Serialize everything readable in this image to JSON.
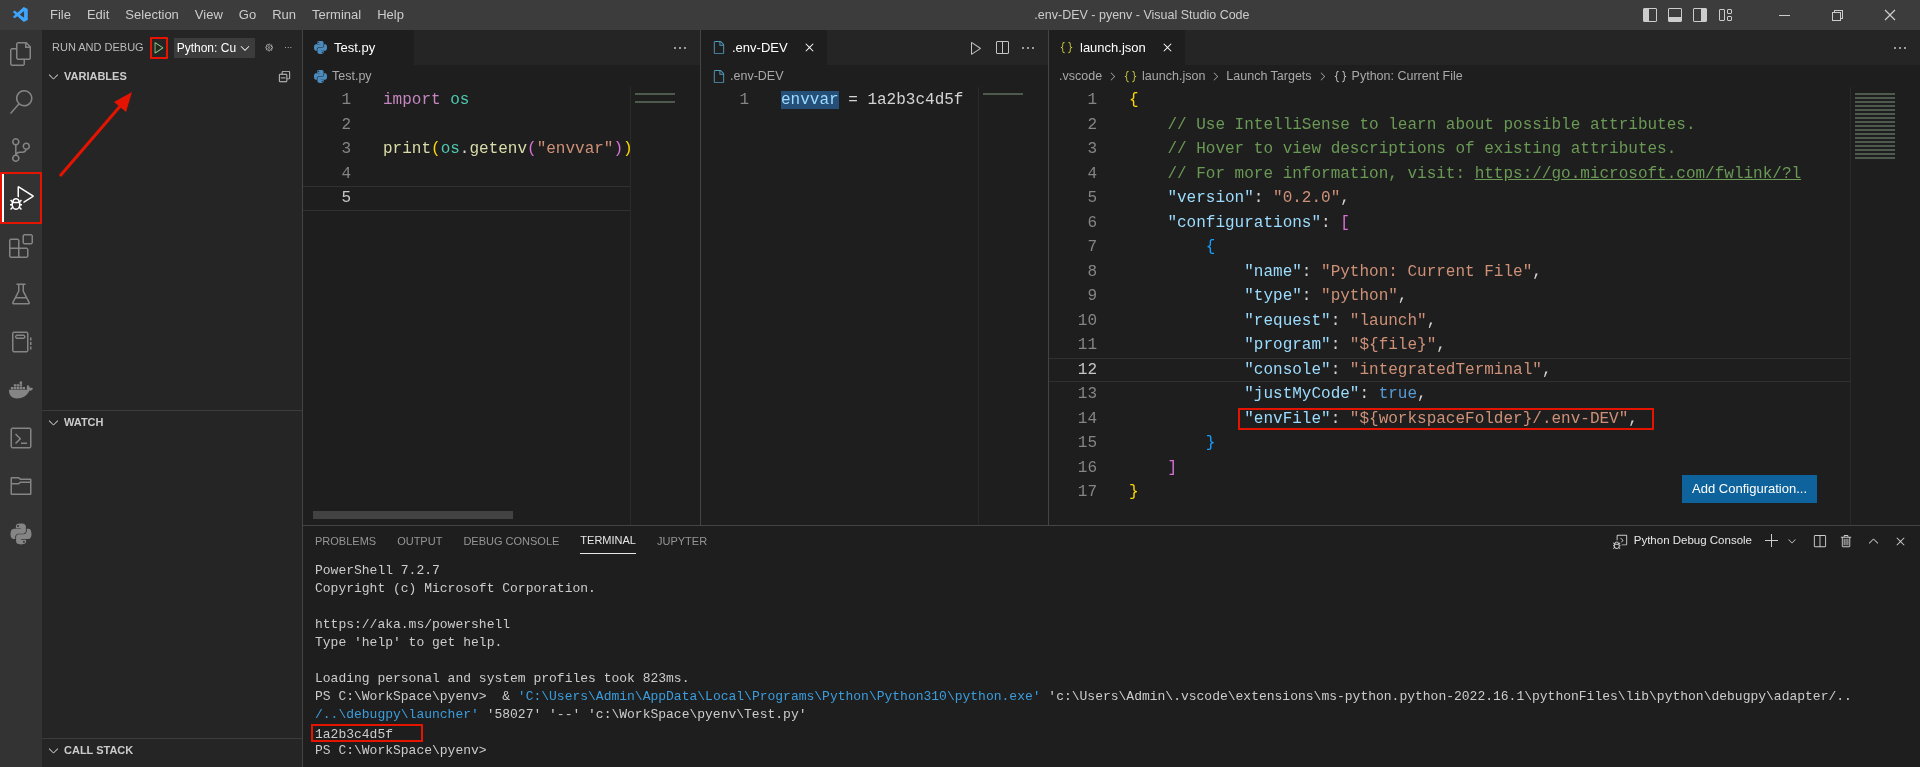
{
  "title_bar": {
    "menu": [
      "File",
      "Edit",
      "Selection",
      "View",
      "Go",
      "Run",
      "Terminal",
      "Help"
    ],
    "title": ".env-DEV - pyenv - Visual Studio Code"
  },
  "activity_bar": [
    {
      "kind": "explorer",
      "selected": false,
      "annotated": false
    },
    {
      "kind": "search",
      "selected": false,
      "annotated": false
    },
    {
      "kind": "scm",
      "selected": false,
      "annotated": false
    },
    {
      "kind": "debug",
      "selected": true,
      "annotated": true
    },
    {
      "kind": "extensions",
      "selected": false,
      "annotated": false
    },
    {
      "kind": "testing",
      "selected": false,
      "annotated": false
    },
    {
      "kind": "notebook",
      "selected": false,
      "annotated": false
    },
    {
      "kind": "docker",
      "selected": false,
      "annotated": false
    },
    {
      "kind": "terminal",
      "selected": false,
      "annotated": false
    },
    {
      "kind": "folder",
      "selected": false,
      "annotated": false
    },
    {
      "kind": "python",
      "selected": false,
      "annotated": false
    }
  ],
  "sidebar": {
    "title": "RUN AND DEBUG",
    "run_button": {
      "annotated": true
    },
    "config": "Python: Cu",
    "sections": [
      {
        "title": "VARIABLES",
        "expanded": true
      },
      {
        "title": "WATCH",
        "expanded": true
      },
      {
        "title": "CALL STACK",
        "expanded": true
      }
    ]
  },
  "editor_groups": [
    {
      "tabs": [
        {
          "label": "Test.py",
          "kind": "python",
          "selected": true,
          "closable": false
        }
      ],
      "runnable": false,
      "breadcrumbs": [
        {
          "kind": "python",
          "label": "Test.py"
        }
      ],
      "lines": [
        {
          "number": "1",
          "current": false,
          "annotated": false,
          "tokens": [
            {
              "kind": "kw",
              "text": "import"
            },
            {
              "kind": "mod",
              "text": " os"
            }
          ]
        },
        {
          "number": "2",
          "current": false,
          "annotated": false
        },
        {
          "number": "3",
          "current": false,
          "annotated": false,
          "tokens": [
            {
              "kind": "fn",
              "text": "print"
            },
            {
              "kind": "p1",
              "text": "("
            },
            {
              "kind": "mod",
              "text": "os"
            },
            {
              "kind": "plain",
              "text": "."
            },
            {
              "kind": "fn",
              "text": "getenv"
            },
            {
              "kind": "p2",
              "text": "("
            },
            {
              "kind": "str",
              "text": "\"envvar\""
            },
            {
              "kind": "p2",
              "text": ")"
            },
            {
              "kind": "p1",
              "text": ")"
            }
          ]
        },
        {
          "number": "4",
          "current": false,
          "annotated": false
        },
        {
          "number": "5",
          "current": true,
          "annotated": false
        }
      ]
    },
    {
      "tabs": [
        {
          "label": ".env-DEV",
          "kind": "file",
          "selected": true,
          "closable": true
        }
      ],
      "runnable": true,
      "breadcrumbs": [
        {
          "kind": "file",
          "label": ".env-DEV"
        }
      ],
      "lines": [
        {
          "number": "1",
          "current": false,
          "annotated": false,
          "tokens": [
            {
              "kind": "sel",
              "text": "envvar"
            },
            {
              "kind": "plain",
              "text": " = 1a2b3c4d5f"
            }
          ]
        }
      ]
    },
    {
      "tabs": [
        {
          "label": "launch.json",
          "kind": "json",
          "selected": true,
          "closable": true
        }
      ],
      "runnable": false,
      "breadcrumbs": [
        {
          "kind": "plain",
          "label": ".vscode"
        },
        {
          "kind": "json",
          "label": "launch.json"
        },
        {
          "kind": "plain",
          "label": "Launch Targets"
        },
        {
          "kind": "object",
          "label": "Python: Current File"
        }
      ],
      "button": "Add Configuration...",
      "lines": [
        {
          "number": "1",
          "current": false,
          "annotated": false,
          "tokens": [
            {
              "kind": "p1",
              "text": "{"
            }
          ]
        },
        {
          "number": "2",
          "current": false,
          "annotated": false,
          "tokens": [
            {
              "kind": "com",
              "text": "    // Use IntelliSense to learn about possible attributes."
            }
          ]
        },
        {
          "number": "3",
          "current": false,
          "annotated": false,
          "tokens": [
            {
              "kind": "com",
              "text": "    // Hover to view descriptions of existing attributes."
            }
          ]
        },
        {
          "number": "4",
          "current": false,
          "annotated": false,
          "tokens": [
            {
              "kind": "com",
              "text": "    // For more information, visit: "
            },
            {
              "kind": "link",
              "text": "https://go.microsoft.com/fwlink/?l"
            }
          ]
        },
        {
          "number": "5",
          "current": false,
          "annotated": false,
          "tokens": [
            {
              "kind": "var",
              "text": "    \"version\""
            },
            {
              "kind": "plain",
              "text": ": "
            },
            {
              "kind": "str",
              "text": "\"0.2.0\""
            },
            {
              "kind": "plain",
              "text": ","
            }
          ]
        },
        {
          "number": "6",
          "current": false,
          "annotated": false,
          "tokens": [
            {
              "kind": "var",
              "text": "    \"configurations\""
            },
            {
              "kind": "plain",
              "text": ": "
            },
            {
              "kind": "p2",
              "text": "["
            }
          ]
        },
        {
          "number": "7",
          "current": false,
          "annotated": false,
          "tokens": [
            {
              "kind": "p3",
              "text": "        {"
            }
          ]
        },
        {
          "number": "8",
          "current": false,
          "annotated": false,
          "tokens": [
            {
              "kind": "var",
              "text": "            \"name\""
            },
            {
              "kind": "plain",
              "text": ": "
            },
            {
              "kind": "str",
              "text": "\"Python: Current File\""
            },
            {
              "kind": "plain",
              "text": ","
            }
          ]
        },
        {
          "number": "9",
          "current": false,
          "annotated": false,
          "tokens": [
            {
              "kind": "var",
              "text": "            \"type\""
            },
            {
              "kind": "plain",
              "text": ": "
            },
            {
              "kind": "str",
              "text": "\"python\""
            },
            {
              "kind": "plain",
              "text": ","
            }
          ]
        },
        {
          "number": "10",
          "current": false,
          "annotated": false,
          "tokens": [
            {
              "kind": "var",
              "text": "            \"request\""
            },
            {
              "kind": "plain",
              "text": ": "
            },
            {
              "kind": "str",
              "text": "\"launch\""
            },
            {
              "kind": "plain",
              "text": ","
            }
          ]
        },
        {
          "number": "11",
          "current": false,
          "annotated": false,
          "tokens": [
            {
              "kind": "var",
              "text": "            \"program\""
            },
            {
              "kind": "plain",
              "text": ": "
            },
            {
              "kind": "str",
              "text": "\"${file}\""
            },
            {
              "kind": "plain",
              "text": ","
            }
          ]
        },
        {
          "number": "12",
          "current": true,
          "annotated": false,
          "tokens": [
            {
              "kind": "var",
              "text": "            \"console\""
            },
            {
              "kind": "plain",
              "text": ": "
            },
            {
              "kind": "str",
              "text": "\"integratedTerminal\""
            },
            {
              "kind": "plain",
              "text": ","
            }
          ]
        },
        {
          "number": "13",
          "current": false,
          "annotated": false,
          "tokens": [
            {
              "kind": "var",
              "text": "            \"justMyCode\""
            },
            {
              "kind": "plain",
              "text": ": "
            },
            {
              "kind": "bool",
              "text": "true"
            },
            {
              "kind": "plain",
              "text": ","
            }
          ]
        },
        {
          "number": "14",
          "current": false,
          "annotated": true,
          "tokens": [
            {
              "kind": "var",
              "text": "            \"envFile\""
            },
            {
              "kind": "plain",
              "text": ": "
            },
            {
              "kind": "str",
              "text": "\"${workspaceFolder}/.env-DEV\""
            },
            {
              "kind": "plain",
              "text": ","
            }
          ]
        },
        {
          "number": "15",
          "current": false,
          "annotated": false,
          "tokens": [
            {
              "kind": "p3",
              "text": "        }"
            }
          ]
        },
        {
          "number": "16",
          "current": false,
          "annotated": false,
          "tokens": [
            {
              "kind": "p2",
              "text": "    ]"
            }
          ]
        },
        {
          "number": "17",
          "current": false,
          "annotated": false,
          "tokens": [
            {
              "kind": "p1",
              "text": "}"
            }
          ]
        }
      ]
    }
  ],
  "panel": {
    "tabs": [
      {
        "label": "PROBLEMS",
        "selected": false
      },
      {
        "label": "OUTPUT",
        "selected": false
      },
      {
        "label": "DEBUG CONSOLE",
        "selected": false
      },
      {
        "label": "TERMINAL",
        "selected": true
      },
      {
        "label": "JUPYTER",
        "selected": false
      }
    ],
    "terminal_name": "Python Debug Console",
    "terminal_lines": [
      {
        "annotated": false,
        "segments": [
          {
            "kind": "plain",
            "text": "PowerShell 7.2.7"
          }
        ]
      },
      {
        "annotated": false,
        "segments": [
          {
            "kind": "plain",
            "text": "Copyright (c) Microsoft Corporation."
          }
        ]
      },
      {
        "annotated": false
      },
      {
        "annotated": false,
        "segments": [
          {
            "kind": "plain",
            "text": "https://aka.ms/powershell"
          }
        ]
      },
      {
        "annotated": false,
        "segments": [
          {
            "kind": "plain",
            "text": "Type 'help' to get help."
          }
        ]
      },
      {
        "annotated": false
      },
      {
        "annotated": false,
        "segments": [
          {
            "kind": "plain",
            "text": "Loading personal and system profiles took 823ms."
          }
        ]
      },
      {
        "annotated": false,
        "segments": [
          {
            "kind": "plain",
            "text": "PS C:\\WorkSpace\\pyenv>  & "
          },
          {
            "kind": "path",
            "text": "'C:\\Users\\Admin\\AppData\\Local\\Programs\\Python\\Python310\\python.exe'"
          },
          {
            "kind": "plain",
            "text": " 'c:\\Users\\Admin\\.vscode\\extensions\\ms-python.python-2022.16.1\\pythonFiles\\lib\\python\\debugpy\\adapter/.."
          }
        ]
      },
      {
        "annotated": false,
        "segments": [
          {
            "kind": "path",
            "text": "/..\\debugpy\\launcher'"
          },
          {
            "kind": "plain",
            "text": " '58027' '--' 'c:\\WorkSpace\\pyenv\\Test.py'"
          }
        ]
      },
      {
        "annotated": true,
        "segments": [
          {
            "kind": "plain",
            "text": "1a2b3c4d5f"
          }
        ]
      },
      {
        "annotated": false,
        "segments": [
          {
            "kind": "plain",
            "text": "PS C:\\WorkSpace\\pyenv>"
          }
        ]
      }
    ]
  }
}
